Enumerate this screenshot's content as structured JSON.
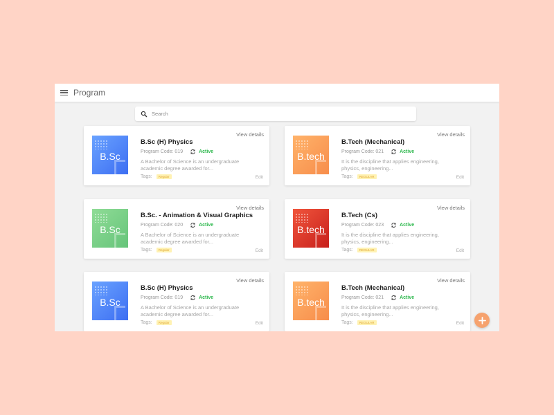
{
  "header": {
    "title": "Program"
  },
  "search": {
    "placeholder": "Search"
  },
  "cards": [
    {
      "abbr": "B.Sc",
      "title": "B.Sc (H) Physics",
      "code": "Program Code: 019",
      "status": "Active",
      "description": "A Bachelor of Science is an undergraduate academic degree awarded for...",
      "tags_label": "Tags:",
      "tag": "Regular",
      "view": "View details",
      "edit": "Edit",
      "color": "#4a7ef5"
    },
    {
      "abbr": "B.tech",
      "title": "B.Tech (Mechanical)",
      "code": "Program Code: 021",
      "status": "Active",
      "description": "It is the discipline that applies engineering, physics, engineering...",
      "tags_label": "Tags:",
      "tag": "REGULAR",
      "view": "View details",
      "edit": "Edit",
      "color": "#f7994e"
    },
    {
      "abbr": "B.Sc",
      "title": "B.Sc. - Animation & Visual Graphics",
      "code": "Program Code: 020",
      "status": "Active",
      "description": "A Bachelor of Science is an undergraduate academic degree awarded for...",
      "tags_label": "Tags:",
      "tag": "Regular",
      "view": "View details",
      "edit": "Edit",
      "color": "#72c985"
    },
    {
      "abbr": "B.tech",
      "title": "B.Tech (Cs)",
      "code": "Program Code: 023",
      "status": "Active",
      "description": "It is the discipline that applies engineering, physics, engineering...",
      "tags_label": "Tags:",
      "tag": "REGULAR",
      "view": "View details",
      "edit": "Edit",
      "color": "#d8302a"
    },
    {
      "abbr": "B.Sc",
      "title": "B.Sc (H) Physics",
      "code": "Program Code: 019",
      "status": "Active",
      "description": "A Bachelor of Science is an undergraduate academic degree awarded for...",
      "tags_label": "Tags:",
      "tag": "Regular",
      "view": "View details",
      "edit": "Edit",
      "color": "#4a7ef5"
    },
    {
      "abbr": "B.tech",
      "title": "B.Tech (Mechanical)",
      "code": "Program Code: 021",
      "status": "Active",
      "description": "It is the discipline that applies engineering, physics, engineering...",
      "tags_label": "Tags:",
      "tag": "REGULAR",
      "view": "View details",
      "edit": "Edit",
      "color": "#f7994e"
    }
  ],
  "fab": {
    "label": "+",
    "icon": "plus-icon"
  },
  "colors": {
    "background": "#ffd4c6",
    "accent": "#f6a26e",
    "active": "#2db84d"
  }
}
